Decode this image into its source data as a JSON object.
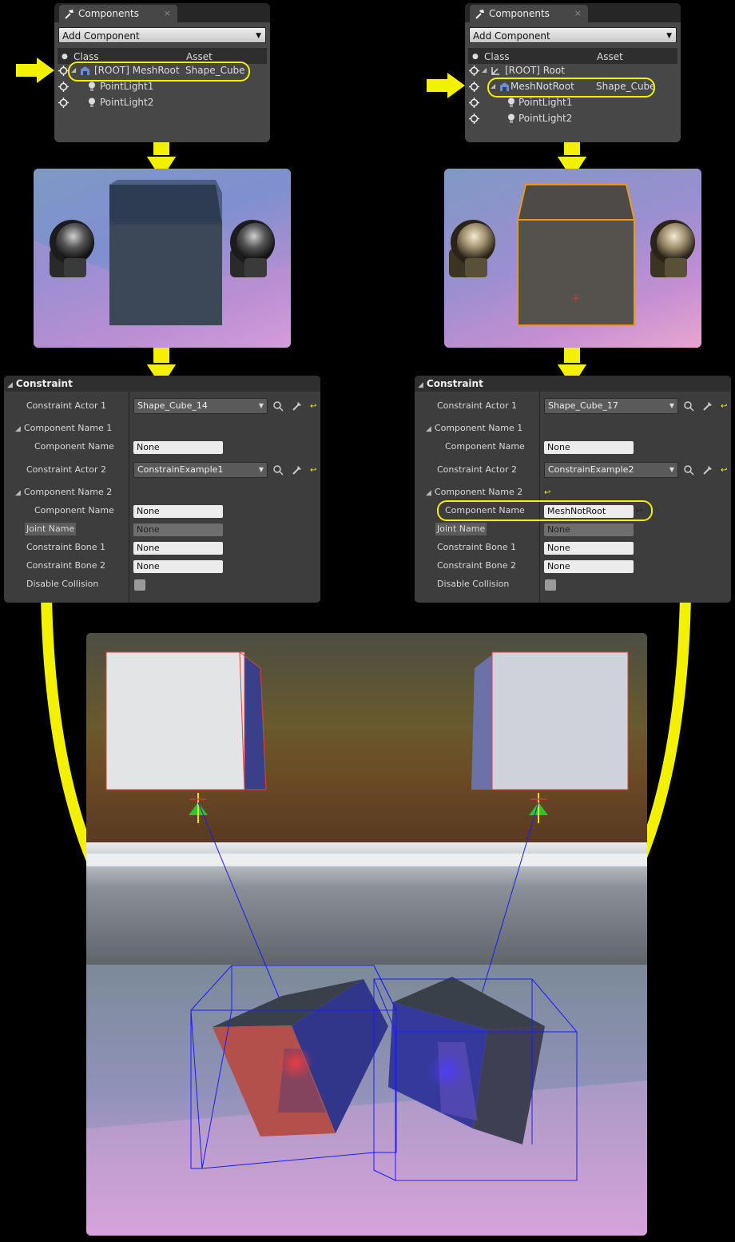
{
  "colors": {
    "highlight": "#f3f000",
    "panel": "#474747",
    "panel_dark": "#2e2e2e",
    "selection_orange": "#e89a16",
    "wire_blue": "#1a1aff"
  },
  "left": {
    "components": {
      "tab_title": "Components",
      "close_glyph": "×",
      "add_label": "Add Component",
      "col_class": "Class",
      "col_asset": "Asset",
      "rows": [
        {
          "label": "[ROOT] MeshRoot",
          "asset": "Shape_Cube",
          "icon": "mesh-icon"
        },
        {
          "label": "PointLight1",
          "icon": "light-bulb-icon"
        },
        {
          "label": "PointLight2",
          "icon": "light-bulb-icon"
        }
      ]
    },
    "constraint": {
      "title": "Constraint",
      "fields": {
        "actor1_label": "Constraint Actor 1",
        "actor1_value": "Shape_Cube_14",
        "comp1_label": "Component Name 1",
        "comp1_name_label": "Component Name",
        "comp1_name_value": "None",
        "actor2_label": "Constraint Actor 2",
        "actor2_value": "ConstrainExample1",
        "comp2_label": "Component Name 2",
        "comp2_name_label": "Component Name",
        "comp2_name_value": "None",
        "joint_label": "Joint Name",
        "joint_value": "None",
        "bone1_label": "Constraint Bone 1",
        "bone1_value": "None",
        "bone2_label": "Constraint Bone 2",
        "bone2_value": "None",
        "collision_label": "Disable Collision"
      }
    }
  },
  "right": {
    "components": {
      "tab_title": "Components",
      "close_glyph": "×",
      "add_label": "Add Component",
      "col_class": "Class",
      "col_asset": "Asset",
      "rows": [
        {
          "label": "[ROOT] Root",
          "icon": "scene-root-icon"
        },
        {
          "label": "MeshNotRoot",
          "asset": "Shape_Cube",
          "icon": "mesh-icon"
        },
        {
          "label": "PointLight1",
          "icon": "light-bulb-icon"
        },
        {
          "label": "PointLight2",
          "icon": "light-bulb-icon"
        }
      ]
    },
    "constraint": {
      "title": "Constraint",
      "fields": {
        "actor1_label": "Constraint Actor 1",
        "actor1_value": "Shape_Cube_17",
        "comp1_label": "Component Name 1",
        "comp1_name_label": "Component Name",
        "comp1_name_value": "None",
        "actor2_label": "Constraint Actor 2",
        "actor2_value": "ConstrainExample2",
        "comp2_label": "Component Name 2",
        "comp2_name_label": "Component Name",
        "comp2_name_value": "MeshNotRoot",
        "joint_label": "Joint Name",
        "joint_value": "None",
        "bone1_label": "Constraint Bone 1",
        "bone1_value": "None",
        "bone2_label": "Constraint Bone 2",
        "bone2_value": "None",
        "collision_label": "Disable Collision"
      }
    }
  }
}
